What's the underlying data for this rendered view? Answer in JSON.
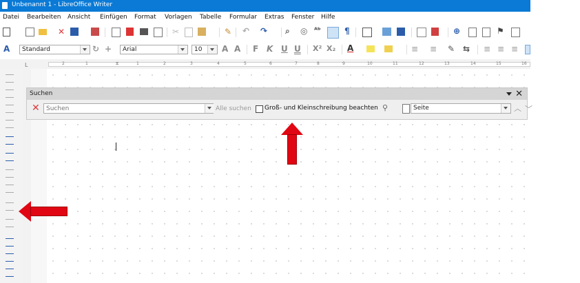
{
  "window": {
    "title": "Unbenannt 1 - LibreOffice Writer"
  },
  "menu": [
    "Datei",
    "Bearbeiten",
    "Ansicht",
    "Einfügen",
    "Format",
    "Vorlagen",
    "Tabelle",
    "Formular",
    "Extras",
    "Fenster",
    "Hilfe"
  ],
  "format_toolbar": {
    "style_value": "Standard",
    "font_value": "Arial",
    "size_value": "10",
    "bold_glyph": "F",
    "italic_glyph": "K",
    "underline_glyph": "U",
    "double_underline_glyph": "U",
    "superscript_glyph": "X²",
    "subscript_glyph": "X₂",
    "font_color_glyph": "A"
  },
  "ruler": {
    "ticks": [
      "2",
      "1",
      "1",
      "2",
      "3",
      "4",
      "5",
      "6",
      "7",
      "8",
      "9",
      "10",
      "11",
      "12",
      "13",
      "14",
      "15",
      "16"
    ]
  },
  "find_toolbar": {
    "title": "Suchen",
    "search_placeholder": "Suchen",
    "find_all_label": "Alle suchen",
    "match_case_label": "Groß- und Kleinschreibung beachten",
    "scope_value": "Seite"
  },
  "colors": {
    "titlebar": "#0a7ad6",
    "annotation_arrow": "#e10613",
    "clear_x": "#e03a3a"
  }
}
